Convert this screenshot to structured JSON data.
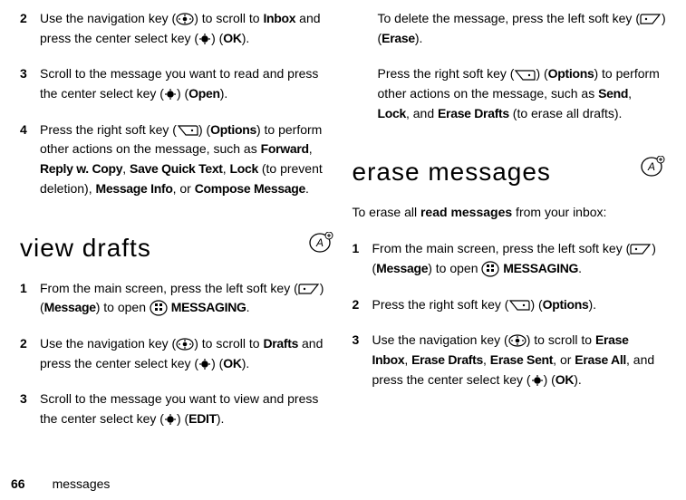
{
  "leftCol": {
    "step2": {
      "num": "2",
      "t1": "Use the navigation key (",
      "t2": ") to scroll to ",
      "t3": "Inbox",
      "t4": " and press the center select key (",
      "t5": ") (",
      "t6": "OK",
      "t7": ")."
    },
    "step3": {
      "num": "3",
      "t1": "Scroll to the message you want to read and press the center select key (",
      "t2": ") (",
      "t3": "Open",
      "t4": ")."
    },
    "step4": {
      "num": "4",
      "t1": "Press the right soft key (",
      "t2": ") (",
      "t3": "Options",
      "t4": ") to perform other actions on the message, such as ",
      "t5": "Forward",
      "t6": ", ",
      "t7": "Reply w. Copy",
      "t8": ", ",
      "t9": "Save Quick Text",
      "t10": ", ",
      "t11": "Lock",
      "t12": " (to prevent deletion), ",
      "t13": "Message Info",
      "t14": ", or ",
      "t15": "Compose Message",
      "t16": "."
    },
    "heading": "view drafts",
    "vstep1": {
      "num": "1",
      "t1": "From the main screen, press the left soft key (",
      "t2": ") (",
      "t3": "Message",
      "t4": ") to open ",
      "t5": "MESSAGING",
      "t6": "."
    },
    "vstep2": {
      "num": "2",
      "t1": "Use the navigation key (",
      "t2": ") to scroll to ",
      "t3": "Drafts",
      "t4": " and press the center select key (",
      "t5": ") (",
      "t6": "OK",
      "t7": ")."
    },
    "vstep3": {
      "num": "3",
      "t1": "Scroll to the message you want to view and press the center select key (",
      "t2": ") (",
      "t3": "EDIT",
      "t4": ")."
    }
  },
  "rightCol": {
    "para1": {
      "t1": "To delete the message, press the left soft key (",
      "t2": ") (",
      "t3": "Erase",
      "t4": ")."
    },
    "para2": {
      "t1": "Press the right soft key (",
      "t2": ") (",
      "t3": "Options",
      "t4": ") to perform other actions on the message, such as ",
      "t5": "Send",
      "t6": ", ",
      "t7": "Lock",
      "t8": ", and ",
      "t9": "Erase Drafts",
      "t10": " (to erase all drafts)."
    },
    "heading": "erase messages",
    "intro": {
      "t1": "To erase all ",
      "t2": "read messages",
      "t3": " from your inbox:"
    },
    "estep1": {
      "num": "1",
      "t1": "From the main screen, press the left soft key (",
      "t2": ") (",
      "t3": "Message",
      "t4": ") to open ",
      "t5": "MESSAGING",
      "t6": "."
    },
    "estep2": {
      "num": "2",
      "t1": "Press the right soft key (",
      "t2": ") (",
      "t3": "Options",
      "t4": ")."
    },
    "estep3": {
      "num": "3",
      "t1": "Use the navigation key (",
      "t2": ") to scroll to ",
      "t3": "Erase Inbox",
      "t4": ", ",
      "t5": "Erase Drafts",
      "t6": ", ",
      "t7": "Erase Sent",
      "t8": ", or ",
      "t9": "Erase All",
      "t10": ", and press the center select key (",
      "t11": ") (",
      "t12": "OK",
      "t13": ")."
    }
  },
  "footer": {
    "page": "66",
    "section": "messages"
  }
}
